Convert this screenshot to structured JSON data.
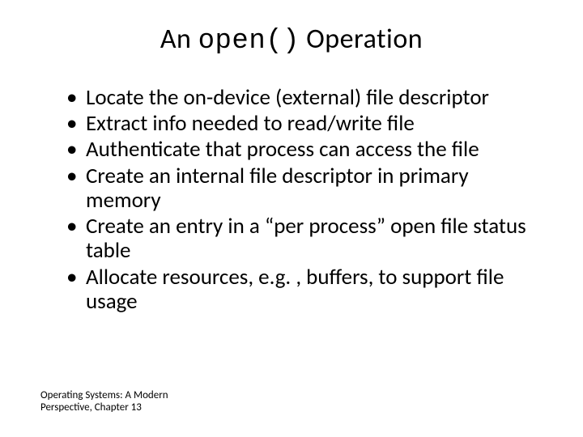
{
  "title": {
    "prefix": "An ",
    "code": "open()",
    "suffix": " Operation"
  },
  "bullets": [
    "Locate the on-device (external) file descriptor",
    "Extract info needed to read/write file",
    "Authenticate that process can access the file",
    "Create an internal file descriptor in primary memory",
    "Create an entry in a “per process” open file status table",
    "Allocate resources, e.g. , buffers, to support file usage"
  ],
  "footer": "Operating Systems: A Modern Perspective, Chapter 13"
}
